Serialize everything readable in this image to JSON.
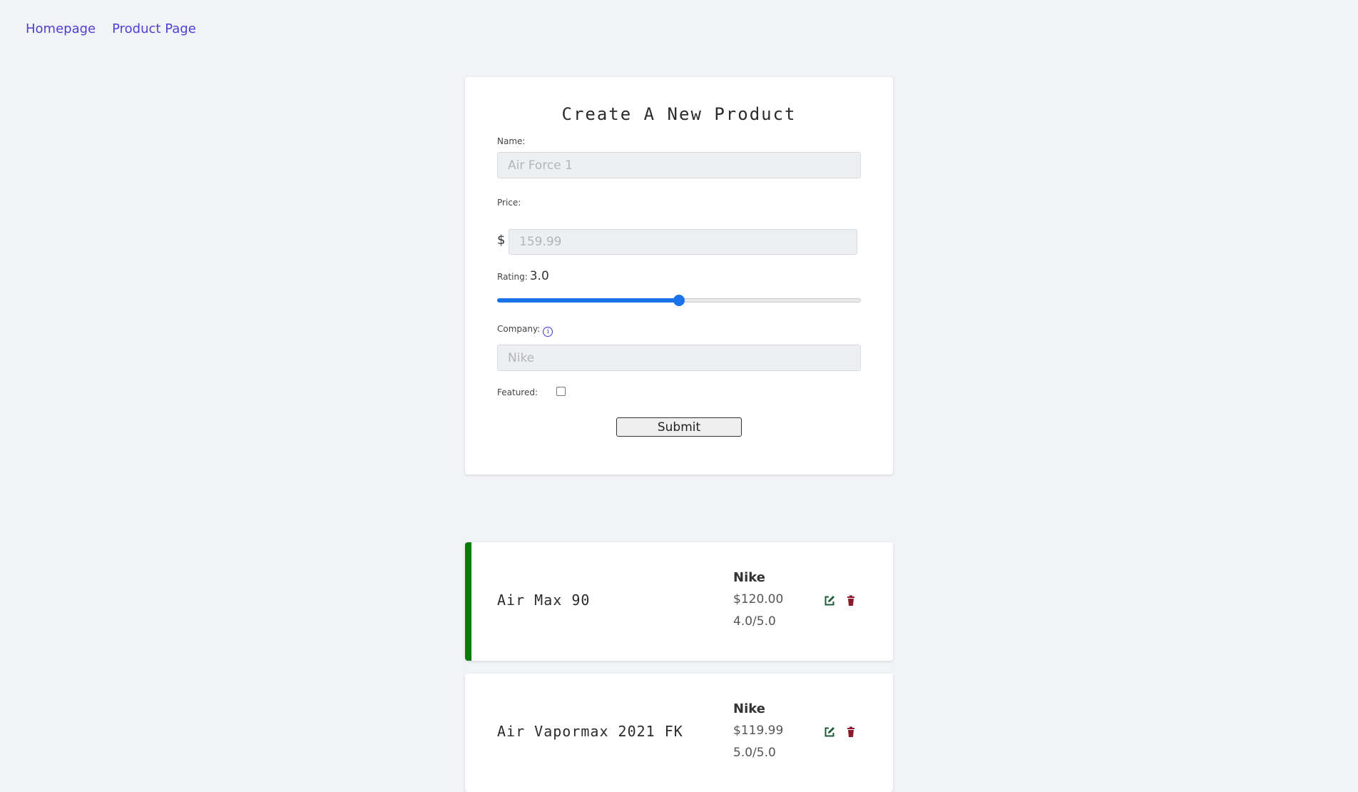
{
  "nav": {
    "links": [
      {
        "label": "Homepage"
      },
      {
        "label": "Product Page"
      }
    ]
  },
  "form": {
    "title": "Create A New Product",
    "name_label": "Name:",
    "name_placeholder": "Air Force 1",
    "price_label": "Price:",
    "price_currency": "$",
    "price_placeholder": "159.99",
    "rating_label": "Rating:",
    "rating_value": "3.0",
    "rating_fraction": 0.5,
    "company_label": "Company:",
    "company_placeholder": "Nike",
    "featured_label": "Featured:",
    "featured_checked": false,
    "submit_label": "Submit"
  },
  "products": [
    {
      "name": "Air Max 90",
      "company": "Nike",
      "price": "$120.00",
      "rating": "4.0/5.0",
      "featured": true
    },
    {
      "name": "Air Vapormax 2021 FK",
      "company": "Nike",
      "price": "$119.99",
      "rating": "5.0/5.0",
      "featured": false
    }
  ],
  "colors": {
    "link": "#4c3fd6",
    "accent": "#1a73e8",
    "featured_border": "#0a7a0a",
    "edit_icon": "#1e5c3a",
    "delete_icon": "#8b1a2b"
  },
  "icons": {
    "edit": "edit-icon",
    "delete": "trash-icon",
    "info": "info-icon"
  }
}
